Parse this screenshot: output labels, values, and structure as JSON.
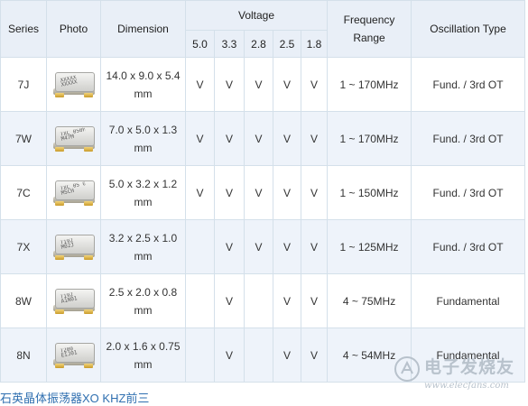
{
  "headers": {
    "series": "Series",
    "photo": "Photo",
    "dimension": "Dimension",
    "voltage": "Voltage",
    "voltages": [
      "5.0",
      "3.3",
      "2.8",
      "2.5",
      "1.8"
    ],
    "frequency": "Frequency\nRange",
    "oscillation": "Oscillation Type"
  },
  "rows": [
    {
      "series": "7J",
      "dimension": "14.0 x 9.0 x 5.4\nmm",
      "v50": "V",
      "v33": "V",
      "v28": "V",
      "v25": "V",
      "v18": "V",
      "freq": "1 ~ 170MHz",
      "osc": "Fund. / 3rd OT",
      "photo_marking": "XXXXX\nXXXXX"
    },
    {
      "series": "7W",
      "dimension": "7.0 x 5.0 x 1.3\nmm",
      "v50": "V",
      "v33": "V",
      "v28": "V",
      "v25": "V",
      "v18": "V",
      "freq": "1 ~ 170MHz",
      "osc": "Fund. / 3rd OT",
      "photo_marking": "TXC 050H\nM47M"
    },
    {
      "series": "7C",
      "dimension": "5.0 x 3.2 x 1.2\nmm",
      "v50": "V",
      "v33": "V",
      "v28": "V",
      "v25": "V",
      "v18": "V",
      "freq": "1 ~ 150MHz",
      "osc": "Fund. / 3rd OT",
      "photo_marking": "TXC 05 0\nM5CH"
    },
    {
      "series": "7X",
      "dimension": "3.2 x 2.5 x 1.0\nmm",
      "v50": "",
      "v33": "V",
      "v28": "V",
      "v25": "V",
      "v18": "V",
      "freq": "1 ~ 125MHz",
      "osc": "Fund. / 3rd OT",
      "photo_marking": "T192\nM02J"
    },
    {
      "series": "8W",
      "dimension": "2.5 x 2.0 x 0.8\nmm",
      "v50": "",
      "v33": "V",
      "v28": "",
      "v25": "V",
      "v18": "V",
      "freq": "4 ~ 75MHz",
      "osc": "Fundamental",
      "photo_marking": "T192\nA1N01"
    },
    {
      "series": "8N",
      "dimension": "2.0 x 1.6 x 0.75\nmm",
      "v50": "",
      "v33": "V",
      "v28": "",
      "v25": "V",
      "v18": "V",
      "freq": "4 ~ 54MHz",
      "osc": "Fundamental",
      "photo_marking": "T200\nEIJ01"
    }
  ],
  "footer_link": "石英晶体振荡器XO         KHZ前三",
  "watermark": {
    "brand": "电子发烧友",
    "url": "www.elecfans.com"
  }
}
